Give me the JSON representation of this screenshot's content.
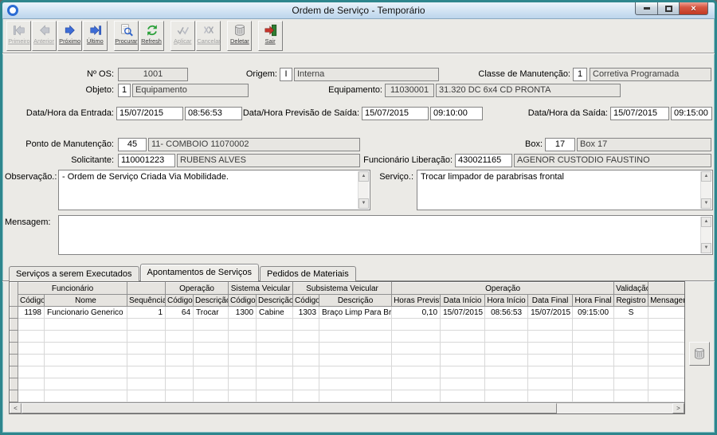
{
  "window": {
    "title": "Ordem de Serviço - Temporário"
  },
  "colors": {
    "frame": "#2e868d",
    "titlebar_top": "#eaf3fb",
    "titlebar_bottom": "#bcd5ec",
    "accent_blue": "#3d6cd6",
    "refresh_green": "#2ba03a",
    "exit_red": "#c4342a",
    "disabled_field_bg": "#e7e6e2",
    "grid_header_bg": "#e6e4e0"
  },
  "toolbar": {
    "buttons": [
      {
        "label": "Primeiro",
        "icon": "first",
        "enabled": false
      },
      {
        "label": "Anterior",
        "icon": "prev",
        "enabled": false
      },
      {
        "label": "Próximo",
        "icon": "next",
        "enabled": true
      },
      {
        "label": "Último",
        "icon": "last",
        "enabled": true
      },
      {
        "label": "Procurar",
        "icon": "search",
        "enabled": true
      },
      {
        "label": "Refresh",
        "icon": "refresh",
        "enabled": true
      },
      {
        "label": "Aplicar",
        "icon": "apply",
        "enabled": false
      },
      {
        "label": "Cancelar",
        "icon": "cancel",
        "enabled": false
      },
      {
        "label": "Deletar",
        "icon": "trash",
        "enabled": true
      },
      {
        "label": "Sair",
        "icon": "exit",
        "enabled": true
      }
    ]
  },
  "form": {
    "nos": {
      "label": "Nº OS:",
      "value": "1001"
    },
    "origem": {
      "label": "Origem:",
      "code": "I",
      "desc": "Interna"
    },
    "classe": {
      "label": "Classe de Manutenção:",
      "code": "1",
      "desc": "Corretiva Programada"
    },
    "objeto": {
      "label": "Objeto:",
      "code": "1",
      "desc": "Equipamento"
    },
    "equipamento": {
      "label": "Equipamento:",
      "code": "11030001",
      "desc": "31.320 DC 6x4 CD PRONTA"
    },
    "entrada": {
      "label": "Data/Hora da Entrada:",
      "date": "15/07/2015",
      "time": "08:56:53"
    },
    "previsao": {
      "label": "Data/Hora Previsão de Saída:",
      "date": "15/07/2015",
      "time": "09:10:00"
    },
    "saida": {
      "label": "Data/Hora da Saída:",
      "date": "15/07/2015",
      "time": "09:15:00"
    },
    "ponto": {
      "label": "Ponto de Manutenção:",
      "code": "45",
      "desc": "11- COMBOIO 11070002"
    },
    "box": {
      "label": "Box:",
      "code": "17",
      "desc": "Box 17"
    },
    "solicitante": {
      "label": "Solicitante:",
      "code": "110001223",
      "desc": "RUBENS ALVES"
    },
    "liberacao": {
      "label": "Funcionário Liberação:",
      "code": "430021165",
      "desc": "AGENOR CUSTODIO FAUSTINO"
    },
    "observacao": {
      "label": "Observação.:",
      "value": "- Ordem de Serviço Criada Via Mobilidade."
    },
    "servico": {
      "label": "Serviço.:",
      "value": "Trocar limpador de parabrisas frontal"
    },
    "mensagem": {
      "label": "Mensagem:",
      "value": ""
    }
  },
  "tabs": [
    {
      "label": "Serviços a serem Executados",
      "active": false
    },
    {
      "label": "Apontamentos de Serviços",
      "active": true
    },
    {
      "label": "Pedidos de Materiais",
      "active": false
    }
  ],
  "grid": {
    "header_groups": [
      {
        "label": "Funcionário",
        "span": 2
      },
      {
        "label": "",
        "span": 1
      },
      {
        "label": "Operação",
        "span": 2
      },
      {
        "label": "Sistema Veicular",
        "span": 2
      },
      {
        "label": "Subsistema Veicular",
        "span": 2
      },
      {
        "label": "Operação",
        "span": 5
      },
      {
        "label": "Validação",
        "span": 1
      },
      {
        "label": "",
        "span": 1
      }
    ],
    "columns": [
      "Código",
      "Nome",
      "Sequência",
      "Código",
      "Descrição",
      "Código",
      "Descrição",
      "Código",
      "Descrição",
      "Horas Prevista",
      "Data Início",
      "Hora Início",
      "Data Final",
      "Hora Final",
      "Registro",
      "Mensagem"
    ],
    "rows": [
      [
        "1198",
        "Funcionario Generico",
        "1",
        "64",
        "Trocar",
        "1300",
        "Cabine",
        "1303",
        "Braço Limp Para Bri",
        "0,10",
        "15/07/2015",
        "08:56:53",
        "15/07/2015",
        "09:15:00",
        "S",
        ""
      ]
    ],
    "empty_row_count": 7
  }
}
